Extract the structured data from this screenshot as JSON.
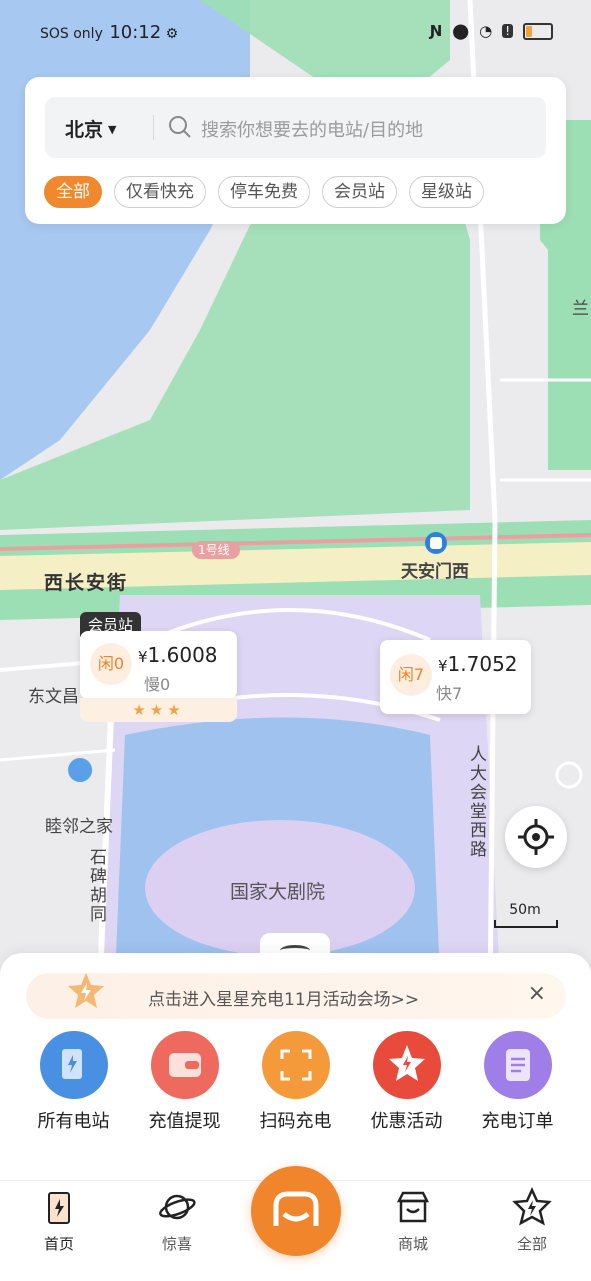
{
  "status_bar": {
    "carrier": "SOS only",
    "time": "10:12",
    "icons": [
      "gear-icon",
      "nfc-icon",
      "location-icon",
      "wifi-icon",
      "alert-icon",
      "battery-icon"
    ]
  },
  "search": {
    "city": "北京",
    "placeholder": "搜索你想要去的电站/目的地",
    "chips": [
      "全部",
      "仅看快充",
      "停车免费",
      "会员站",
      "星级站"
    ]
  },
  "map": {
    "labels": {
      "line1": "1号线",
      "avenue": "西长安街",
      "station": "天安门西",
      "neighbor": "睦邻之家",
      "dongwenchang": "东文昌",
      "lan": "兰",
      "theater": "国家大剧院",
      "shibei": "石碑胡同",
      "renda": "人大会堂西路",
      "scale": "50m"
    },
    "markers": [
      {
        "tag": "会员站",
        "idle": "闲0",
        "price": "1.6008",
        "currency": "¥",
        "sub": "慢0",
        "stars": "★★★"
      },
      {
        "idle": "闲7",
        "price": "1.7052",
        "currency": "¥",
        "sub": "快7"
      }
    ]
  },
  "promo": {
    "text": "点击进入星星充电11月活动会场>>",
    "close": "×"
  },
  "features": [
    {
      "label": "所有电站",
      "icon": "station-icon",
      "color": "#4a90e2"
    },
    {
      "label": "充值提现",
      "icon": "wallet-icon",
      "color": "#ef6a5e"
    },
    {
      "label": "扫码充电",
      "icon": "scan-icon",
      "color": "#f59a3a"
    },
    {
      "label": "优惠活动",
      "icon": "star-badge-icon",
      "color": "#e84a3c"
    },
    {
      "label": "充电订单",
      "icon": "clipboard-icon",
      "color": "#a07ee8"
    }
  ],
  "tabs": [
    {
      "label": "首页",
      "icon": "home-charger-icon"
    },
    {
      "label": "惊喜",
      "icon": "planet-icon"
    },
    {
      "label": "商城",
      "icon": "store-icon"
    },
    {
      "label": "全部",
      "icon": "star-bolt-icon"
    }
  ]
}
